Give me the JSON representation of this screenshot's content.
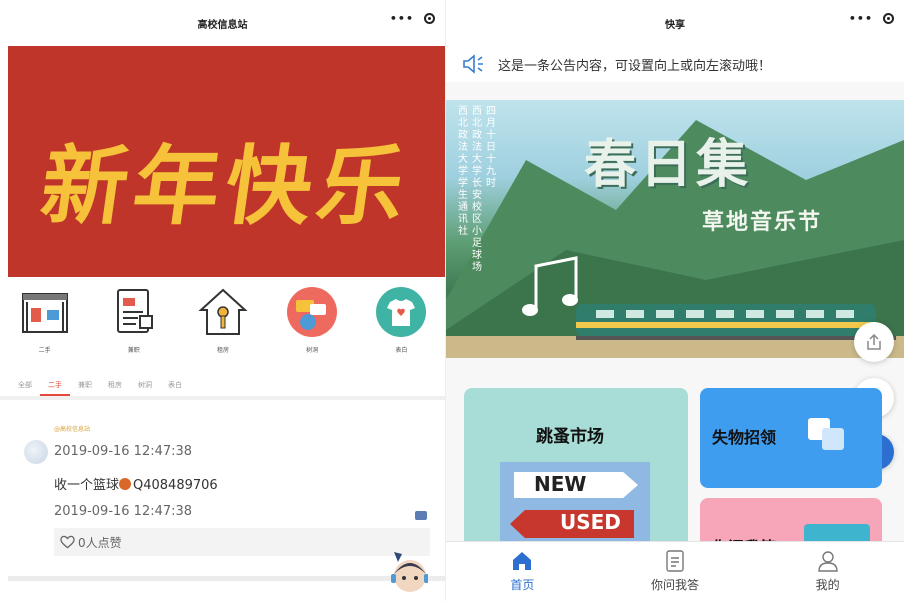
{
  "left": {
    "nav_title": "高校信息站",
    "banner_text": "新年快乐",
    "categories": [
      {
        "label": "二手",
        "icon": "shop-icon"
      },
      {
        "label": "兼职",
        "icon": "document-icon"
      },
      {
        "label": "租房",
        "icon": "house-key-icon"
      },
      {
        "label": "树洞",
        "icon": "chat-globe-icon"
      },
      {
        "label": "表白",
        "icon": "love-tshirt-icon"
      }
    ],
    "tabs": [
      "全部",
      "二手",
      "兼职",
      "租房",
      "树洞",
      "表白"
    ],
    "active_tab": "二手",
    "post": {
      "author": "@高校信息站",
      "time": "2019-09-16 12:47:38",
      "content": "收一个篮球",
      "contact": "Q408489706",
      "time2": "2019-09-16 12:47:38",
      "likes": "0人点赞"
    }
  },
  "right": {
    "nav_title": "快享",
    "notice": "这是一条公告内容，可设置向上或向左滚动哦！",
    "poster": {
      "title": "春日集",
      "subtitle": "草地音乐节",
      "vertical_1": "四月十日十九时",
      "vertical_2": "西北政法大学长安校区小足球场",
      "vertical_3": "西北政法大学学生通讯社"
    },
    "cards": {
      "market": "跳蚤市场",
      "market_new": "NEW",
      "market_used": "USED",
      "lost": "失物招领",
      "qa": "你问我答"
    },
    "tabbar": [
      {
        "label": "首页",
        "icon": "home-icon"
      },
      {
        "label": "你问我答",
        "icon": "document-icon"
      },
      {
        "label": "我的",
        "icon": "user-icon"
      }
    ]
  },
  "colors": {
    "banner_red": "#c0352a",
    "banner_gold": "#f5c23a",
    "accent_red": "#e3483b",
    "accent_blue": "#2c6fd1",
    "market_card": "#a8dcd6",
    "lost_card": "#3f9df0",
    "qa_card": "#f7a6b9"
  }
}
